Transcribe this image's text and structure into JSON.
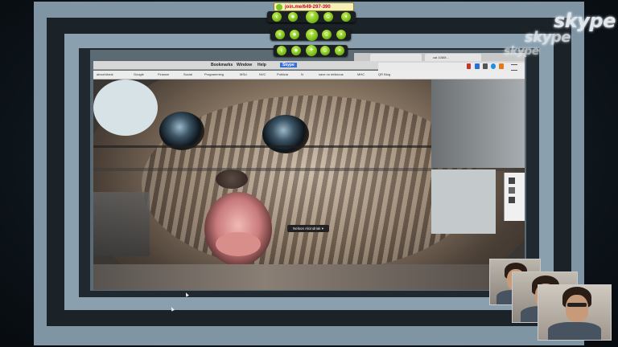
{
  "toolbar": {
    "join_url": "join.me/649-297-390"
  },
  "skype": {
    "logo_text": "skype"
  },
  "browser": {
    "menu_items": [
      "Bookmarks",
      "Window",
      "Help"
    ],
    "active_menu": "Skype",
    "bookmarks": [
      "about:blank",
      "Google",
      "Finance",
      "Social",
      "Programming",
      "MSU",
      "NVC",
      "Publicia",
      "N",
      "save on delicious",
      "MHC",
      "QR Blog"
    ],
    "tabs": [
      "",
      "cat 1080t..."
    ]
  },
  "tooltip": {
    "text": "Nelson Alcindriak ▾"
  },
  "colors": {
    "accent_green": "#7dc221",
    "url_red": "#c1002a"
  }
}
